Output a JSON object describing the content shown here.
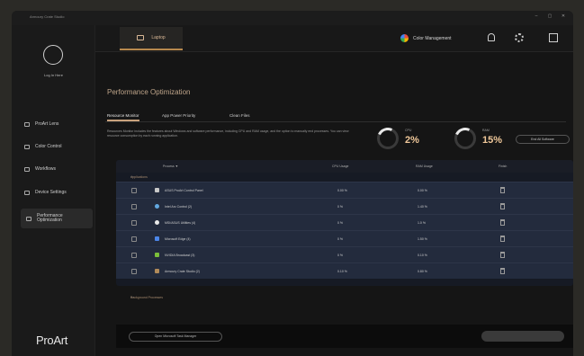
{
  "window": {
    "title": "Armoury Crate Studio"
  },
  "window_controls": [
    "–",
    "▢",
    "✕"
  ],
  "sidebar": {
    "login_label": "Log In Here",
    "items": [
      {
        "label": "ProArt Lens",
        "icon": "lens-icon",
        "active": false
      },
      {
        "label": "Color Control",
        "icon": "color-icon",
        "active": false
      },
      {
        "label": "Workflows",
        "icon": "workflow-icon",
        "active": false
      },
      {
        "label": "Device Settings",
        "icon": "device-icon",
        "active": false
      },
      {
        "label": "Performance Optimization",
        "icon": "performance-icon",
        "active": true
      }
    ],
    "brand": "ProArt"
  },
  "topbar": {
    "device_tab": "Laptop",
    "color_management": "Color Management"
  },
  "page": {
    "title": "Performance Optimization",
    "tabs": [
      "Resource Monitor",
      "App Power Priority",
      "Clean Files"
    ],
    "description": "Resources Monitor includes the features about Windows and software performance, including CPU and RAM usage, and the option to manually end processes. You can view resource consumption by each running application."
  },
  "stats": {
    "cpu_label": "CPU",
    "cpu_value": "2%",
    "ram_label": "RAM",
    "ram_value": "15%",
    "end_all_label": "End All Software"
  },
  "table": {
    "headers": {
      "process": "Process ▼",
      "cpu": "CPU Usage",
      "ram": "RAM Usage",
      "end": "Finish"
    },
    "section_applications": "Applications",
    "section_background": "Background Processes",
    "rows": [
      {
        "name": "ASUS ProArt Control Panel",
        "cpu": "0.00 %",
        "ram": "0.00 %",
        "color": "#c8c8c8"
      },
      {
        "name": "Intel Arc Control (2)",
        "cpu": "0 %",
        "ram": "1.40 %",
        "color": "#62a8e0"
      },
      {
        "name": "MSI/ASUS Utilities (4)",
        "cpu": "0 %",
        "ram": "1.0 %",
        "color": "#e8e8e8"
      },
      {
        "name": "Microsoft Edge (4)",
        "cpu": "0 %",
        "ram": "1.50 %",
        "color": "#4c86e8"
      },
      {
        "name": "NVIDIA Broadcast (3)",
        "cpu": "0 %",
        "ram": "0.10 %",
        "color": "#7bbf3a"
      },
      {
        "name": "Armoury Crate Studio (2)",
        "cpu": "0.10 %",
        "ram": "0.80 %",
        "color": "#b08a5a"
      }
    ]
  },
  "footer": {
    "ms_button": "Open Microsoft Task Manager"
  }
}
